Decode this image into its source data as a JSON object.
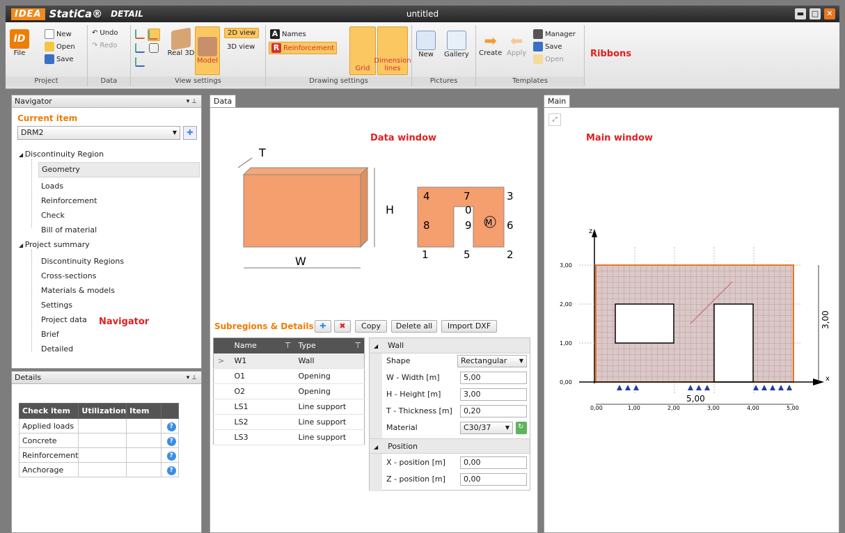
{
  "app": {
    "logo_idea": "IDEA",
    "logo_statica": "StatiCa®",
    "logo_detail": "DETAIL",
    "doc_title": "untitled"
  },
  "ribbon": {
    "file": "File",
    "new": "New",
    "open": "Open",
    "save": "Save",
    "undo": "Undo",
    "redo": "Redo",
    "real3d": "Real 3D",
    "model": "Model",
    "view2d": "2D view",
    "view3d": "3D view",
    "names": "Names",
    "reinforcement": "Reinforcement",
    "grid": "Grid",
    "dimension_lines": "Dimension lines",
    "pic_new": "New",
    "gallery": "Gallery",
    "create": "Create",
    "apply": "Apply",
    "manager": "Manager",
    "tpl_save": "Save",
    "tpl_open": "Open",
    "groups": {
      "project": "Project",
      "data": "Data",
      "view_settings": "View settings",
      "drawing_settings": "Drawing settings",
      "pictures": "Pictures",
      "templates": "Templates"
    },
    "annotation": "Ribbons"
  },
  "navigator": {
    "title": "Navigator",
    "current_item_label": "Current item",
    "current_item_value": "DRM2",
    "annotation": "Navigator",
    "tree": {
      "discontinuity_region": "Discontinuity Region",
      "geometry": "Geometry",
      "loads": "Loads",
      "reinforcement": "Reinforcement",
      "check": "Check",
      "bill_of_material": "Bill of material",
      "project_summary": "Project summary",
      "discontinuity_regions": "Discontinuity Regions",
      "cross_sections": "Cross-sections",
      "materials_models": "Materials & models",
      "settings": "Settings",
      "project_data": "Project data",
      "brief": "Brief",
      "detailed": "Detailed"
    }
  },
  "details": {
    "title": "Details",
    "headers": [
      "Check item",
      "Utilization",
      "Item"
    ],
    "rows": [
      "Applied loads",
      "Concrete",
      "Reinforcement",
      "Anchorage"
    ]
  },
  "data_window": {
    "tab": "Data",
    "annotation": "Data window",
    "sketch": {
      "T": "T",
      "H": "H",
      "W": "W",
      "n1": "1",
      "n2": "2",
      "n3": "3",
      "n4": "4",
      "n5": "5",
      "n6": "6",
      "n7": "7",
      "n8": "8",
      "n9": "9",
      "n0": "0",
      "M": "M"
    },
    "subregions": {
      "title": "Subregions & Details",
      "copy": "Copy",
      "delete_all": "Delete all",
      "import_dxf": "Import DXF",
      "col_name": "Name",
      "col_type": "Type",
      "rows": [
        {
          "name": "W1",
          "type": "Wall"
        },
        {
          "name": "O1",
          "type": "Opening"
        },
        {
          "name": "O2",
          "type": "Opening"
        },
        {
          "name": "LS1",
          "type": "Line support"
        },
        {
          "name": "LS2",
          "type": "Line support"
        },
        {
          "name": "LS3",
          "type": "Line support"
        }
      ]
    },
    "props": {
      "wall": "Wall",
      "shape": "Shape",
      "shape_val": "Rectangular",
      "width": "W - Width [m]",
      "width_val": "5,00",
      "height": "H - Height [m]",
      "height_val": "3,00",
      "thickness": "T - Thickness [m]",
      "thickness_val": "0,20",
      "material": "Material",
      "material_val": "C30/37",
      "position": "Position",
      "xpos": "X - position [m]",
      "xpos_val": "0,00",
      "zpos": "Z - position [m]",
      "zpos_val": "0,00"
    }
  },
  "main_window": {
    "tab": "Main",
    "annotation": "Main window",
    "axis_z": "z",
    "axis_x": "x",
    "y_ticks": [
      "3,00",
      "2,00",
      "1,00",
      "0,00"
    ],
    "x_ticks": [
      "0,00",
      "1,00",
      "2,00",
      "3,00",
      "4,00",
      "5,00"
    ],
    "dim_w": "5,00",
    "dim_h": "3,00"
  }
}
